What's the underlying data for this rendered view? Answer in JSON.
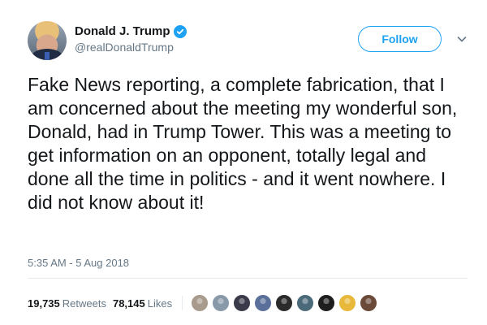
{
  "tweet": {
    "author": {
      "display_name": "Donald J. Trump",
      "handle": "@realDonaldTrump",
      "verified": true,
      "avatar_icon": "profile-photo"
    },
    "follow_label": "Follow",
    "menu_icon": "chevron-down-icon",
    "text": "Fake News reporting, a complete fabrication, that I am concerned about the meeting my wonderful son, Donald, had in Trump Tower. This was a meeting to get information on an opponent, totally legal and done all the time in politics - and it went nowhere. I did not know about it!",
    "timestamp": "5:35 AM - 5 Aug 2018",
    "stats": {
      "retweets_count": "19,735",
      "retweets_label": "Retweets",
      "likes_count": "78,145",
      "likes_label": "Likes"
    },
    "likers": [
      {
        "color": "#a89a8c"
      },
      {
        "color": "#8899aa"
      },
      {
        "color": "#3a3a4a"
      },
      {
        "color": "#5a6f9a"
      },
      {
        "color": "#2b2b2b"
      },
      {
        "color": "#4a6a7a"
      },
      {
        "color": "#1e1e1e"
      },
      {
        "color": "#e8b83a"
      },
      {
        "color": "#6b4a3a"
      }
    ]
  },
  "colors": {
    "accent": "#1da1f2",
    "text": "#14171a",
    "secondary_text": "#657786",
    "divider": "#e6ecf0"
  }
}
